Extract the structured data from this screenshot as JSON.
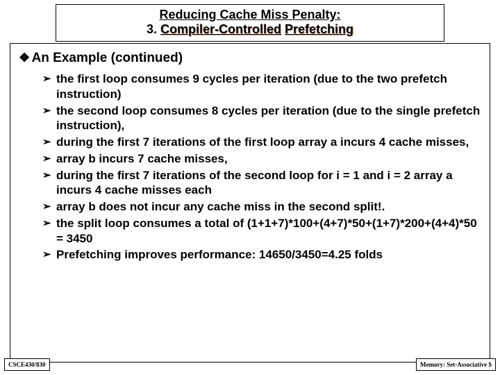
{
  "title": {
    "line1": "Reducing Cache Miss Penalty:",
    "line2_prefix": "3. ",
    "line2_mid": "Compiler-Controlled",
    "line2_space": " ",
    "line2_end": "Prefetching"
  },
  "section": {
    "heading": "An Example (continued)"
  },
  "bullets": [
    "the first loop consumes 9 cycles per iteration (due to the two prefetch instruction)",
    " the second loop consumes 8 cycles per iteration (due to the single prefetch instruction),",
    "during the first 7 iterations of the first loop array a incurs 4 cache misses,",
    " array b incurs 7 cache misses,",
    " during the first 7 iterations of the second loop for i = 1 and i = 2 array a incurs 4 cache misses each",
    " array b does not incur any cache miss in the second split!.",
    "the split loop consumes a total of (1+1+7)*100+(4+7)*50+(1+7)*200+(4+4)*50 = 3450",
    "Prefetching improves performance: 14650/3450=4.25 folds"
  ],
  "footer": {
    "left": "CSCE430/830",
    "right": "Memory: Set-Associative $"
  }
}
